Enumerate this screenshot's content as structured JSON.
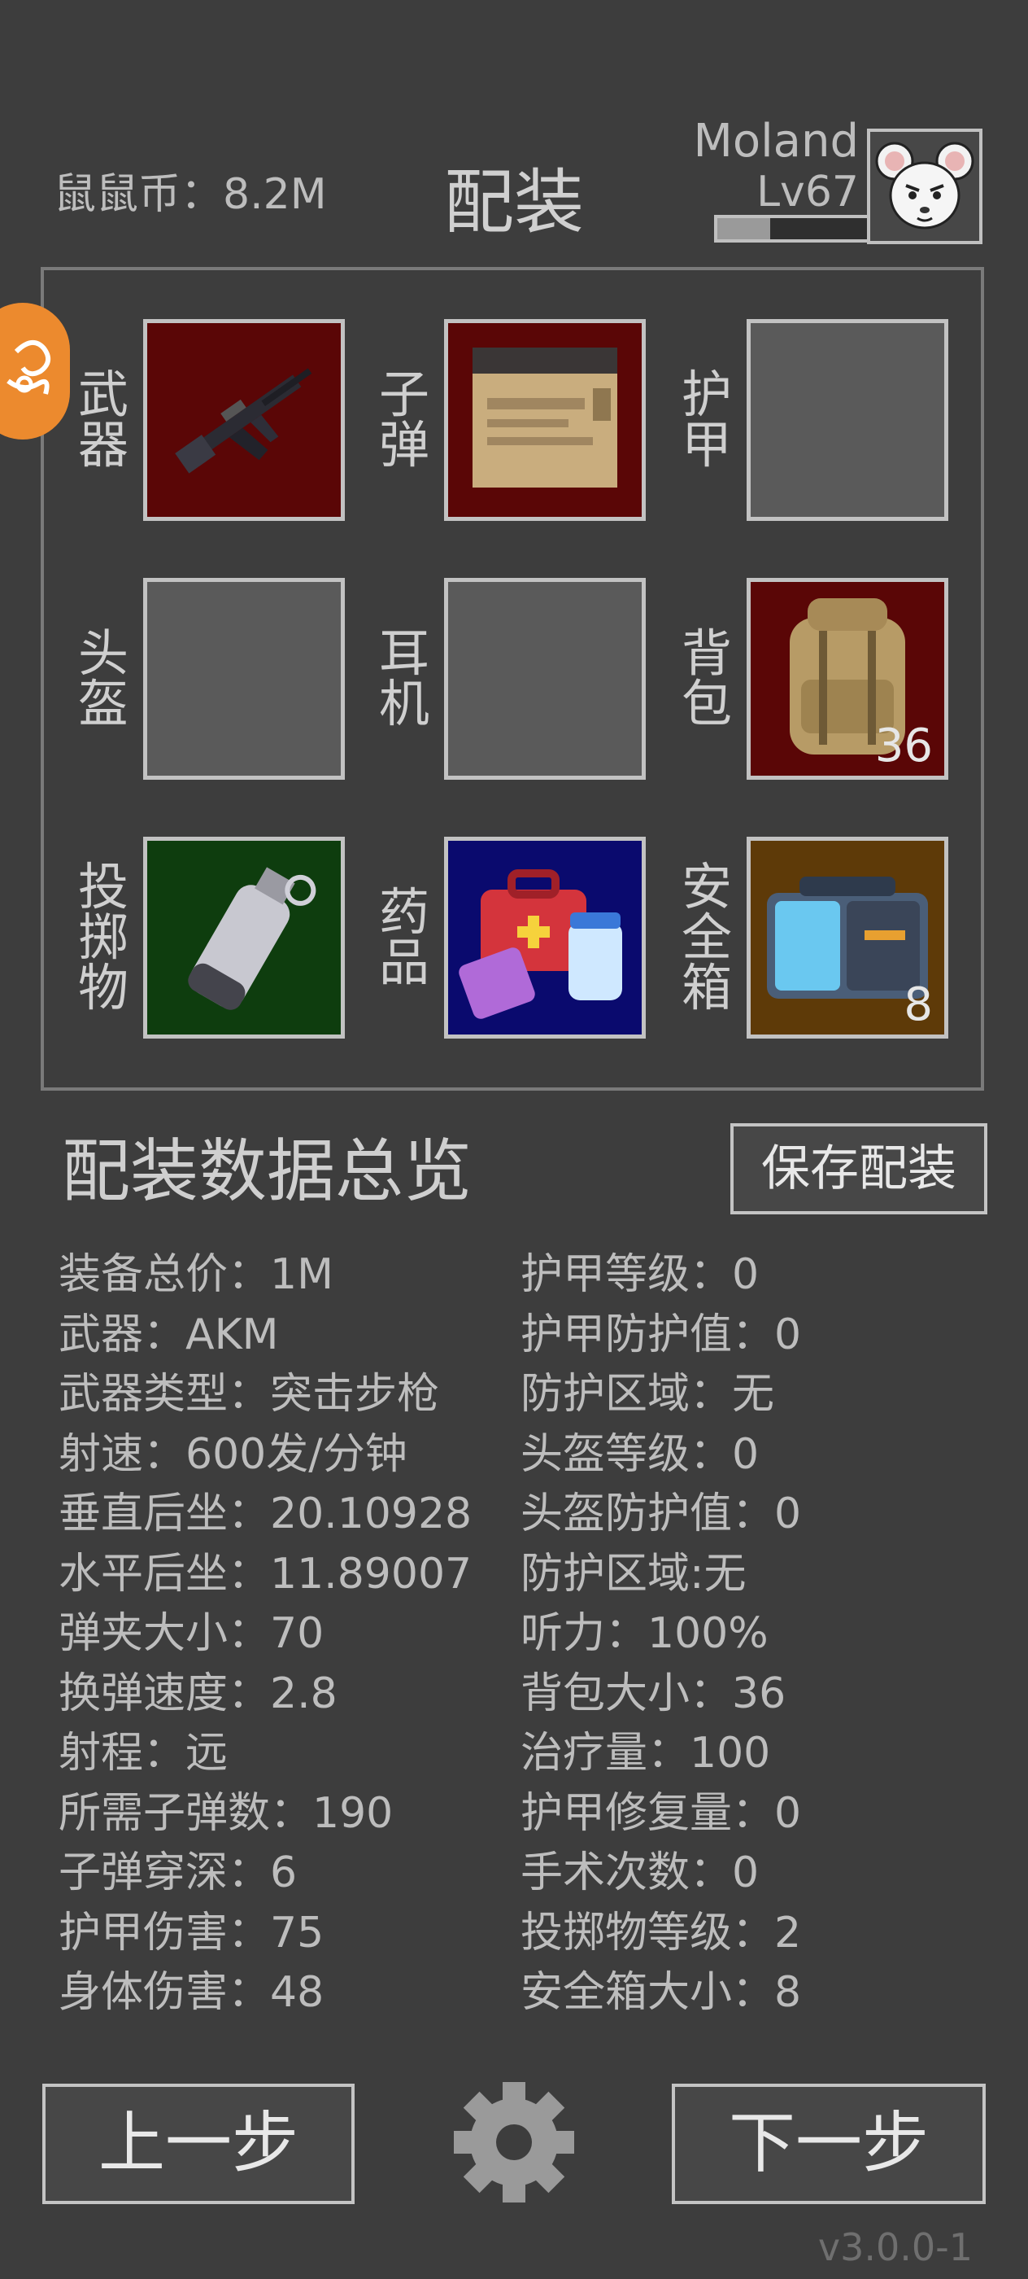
{
  "header": {
    "currency_label": "鼠鼠币：8.2M",
    "title": "配装",
    "username": "Moland",
    "level": "Lv67",
    "xp_progress": 0.35
  },
  "slots": [
    {
      "label": "武器",
      "count": "",
      "bg": "#5a0606",
      "item": "rifle-icon"
    },
    {
      "label": "子弹",
      "count": "",
      "bg": "#5a0606",
      "item": "ammo-box-icon"
    },
    {
      "label": "护甲",
      "count": "",
      "bg": "#5a5a5a",
      "item": ""
    },
    {
      "label": "头盔",
      "count": "",
      "bg": "#5a5a5a",
      "item": ""
    },
    {
      "label": "耳机",
      "count": "",
      "bg": "#5a5a5a",
      "item": ""
    },
    {
      "label": "背包",
      "count": "36",
      "bg": "#5a0606",
      "item": "backpack-icon"
    },
    {
      "label": "投掷物",
      "count": "",
      "bg": "#0e3d0e",
      "item": "grenade-icon"
    },
    {
      "label": "药品",
      "count": "",
      "bg": "#0a0a6e",
      "item": "medkit-icon"
    },
    {
      "label": "安全箱",
      "count": "8",
      "bg": "#5e3a08",
      "item": "safe-box-icon"
    }
  ],
  "overview_title": "配装数据总览",
  "save_button": "保存配装",
  "stats_left": [
    "装备总价：1M",
    "武器：AKM",
    "武器类型：突击步枪",
    "射速：600发/分钟",
    "垂直后坐：20.10928",
    "水平后坐：11.89007",
    "弹夹大小：70",
    "换弹速度：2.8",
    "射程：远",
    "所需子弹数：190",
    "子弹穿深：6",
    "护甲伤害：75",
    "身体伤害：48"
  ],
  "stats_right": [
    "护甲等级：0",
    "护甲防护值：0",
    "防护区域：无",
    "头盔等级：0",
    "头盔防护值：0",
    "防护区域:无",
    "听力：100%",
    "背包大小：36",
    "治疗量：100",
    "护甲修复量：0",
    "手术次数：0",
    "投掷物等级：2",
    "安全箱大小：8"
  ],
  "prev_button": "上一步",
  "next_button": "下一步",
  "version": "v3.0.0-1",
  "colors": {
    "background": "#3d3d3d",
    "fab": "#ec8a2e"
  }
}
